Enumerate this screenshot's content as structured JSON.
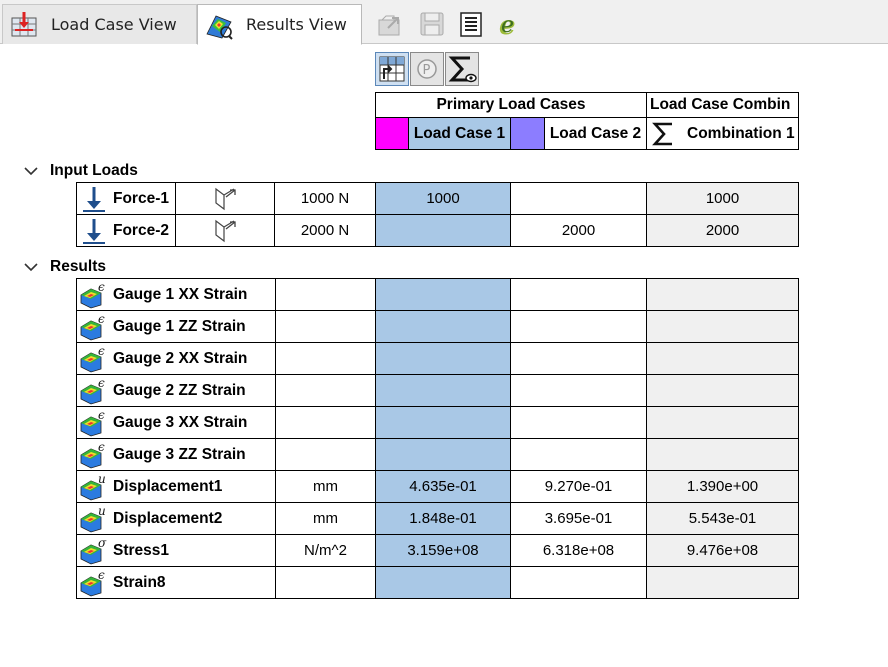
{
  "tabs": [
    {
      "label": "Load Case View",
      "active": false,
      "icon": "load-case-view-icon"
    },
    {
      "label": "Results View",
      "active": true,
      "icon": "results-view-icon"
    }
  ],
  "toolbar": {
    "icons": [
      "import-icon",
      "save-icon",
      "list-icon",
      "excel-export-icon"
    ]
  },
  "mode_buttons": [
    "table-view-icon",
    "parameter-icon",
    "sum-icon"
  ],
  "headers": {
    "primary": "Primary Load Cases",
    "combination": "Load Case Combin",
    "load_case_1": "Load Case 1",
    "load_case_2": "Load Case 2",
    "combination_1": "Combination 1",
    "load_case_1_color": "#ff00ff",
    "load_case_2_color": "#8c7dff"
  },
  "groups": {
    "input_loads": "Input Loads",
    "results": "Results"
  },
  "input_loads": [
    {
      "name": "Force-1",
      "magnitude": "1000 N",
      "lc1": "1000",
      "lc2": "",
      "comb": "1000"
    },
    {
      "name": "Force-2",
      "magnitude": "2000 N",
      "lc1": "",
      "lc2": "2000",
      "comb": "2000"
    }
  ],
  "results": [
    {
      "name": "Gauge 1 XX Strain",
      "symbol": "ϵ",
      "units": "",
      "lc1": "",
      "lc2": "",
      "comb": ""
    },
    {
      "name": "Gauge 1 ZZ Strain",
      "symbol": "ϵ",
      "units": "",
      "lc1": "",
      "lc2": "",
      "comb": ""
    },
    {
      "name": "Gauge 2 XX Strain",
      "symbol": "ϵ",
      "units": "",
      "lc1": "",
      "lc2": "",
      "comb": ""
    },
    {
      "name": "Gauge 2 ZZ Strain",
      "symbol": "ϵ",
      "units": "",
      "lc1": "",
      "lc2": "",
      "comb": ""
    },
    {
      "name": "Gauge 3 XX Strain",
      "symbol": "ϵ",
      "units": "",
      "lc1": "",
      "lc2": "",
      "comb": ""
    },
    {
      "name": "Gauge 3 ZZ Strain",
      "symbol": "ϵ",
      "units": "",
      "lc1": "",
      "lc2": "",
      "comb": ""
    },
    {
      "name": "Displacement1",
      "symbol": "u",
      "units": "mm",
      "lc1": "4.635e-01",
      "lc2": "9.270e-01",
      "comb": "1.390e+00"
    },
    {
      "name": "Displacement2",
      "symbol": "u",
      "units": "mm",
      "lc1": "1.848e-01",
      "lc2": "3.695e-01",
      "comb": "5.543e-01"
    },
    {
      "name": "Stress1",
      "symbol": "σ",
      "units": "N/m^2",
      "lc1": "3.159e+08",
      "lc2": "6.318e+08",
      "comb": "9.476e+08"
    },
    {
      "name": "Strain8",
      "symbol": "ϵ",
      "units": "",
      "lc1": "",
      "lc2": "",
      "comb": ""
    }
  ]
}
